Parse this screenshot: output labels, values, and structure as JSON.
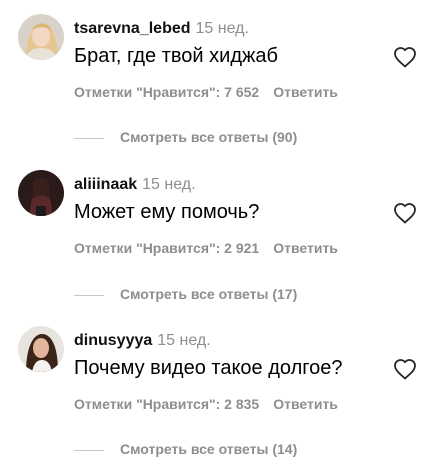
{
  "comments": [
    {
      "username": "tsarevna_lebed",
      "time": "15 нед.",
      "text": "Брат, где твой хиджаб",
      "likes_label": "Отметки \"Нравится\": 7 652",
      "reply_label": "Ответить",
      "view_replies": "Смотреть все ответы (90)"
    },
    {
      "username": "aliiinaak",
      "time": "15 нед.",
      "text": "Может ему помочь?",
      "likes_label": "Отметки \"Нравится\": 2 921",
      "reply_label": "Ответить",
      "view_replies": "Смотреть все ответы (17)"
    },
    {
      "username": "dinusyyya",
      "time": "15 нед.",
      "text": "Почему видео такое долгое?",
      "likes_label": "Отметки \"Нравится\": 2 835",
      "reply_label": "Ответить",
      "view_replies": "Смотреть все ответы (14)"
    }
  ]
}
